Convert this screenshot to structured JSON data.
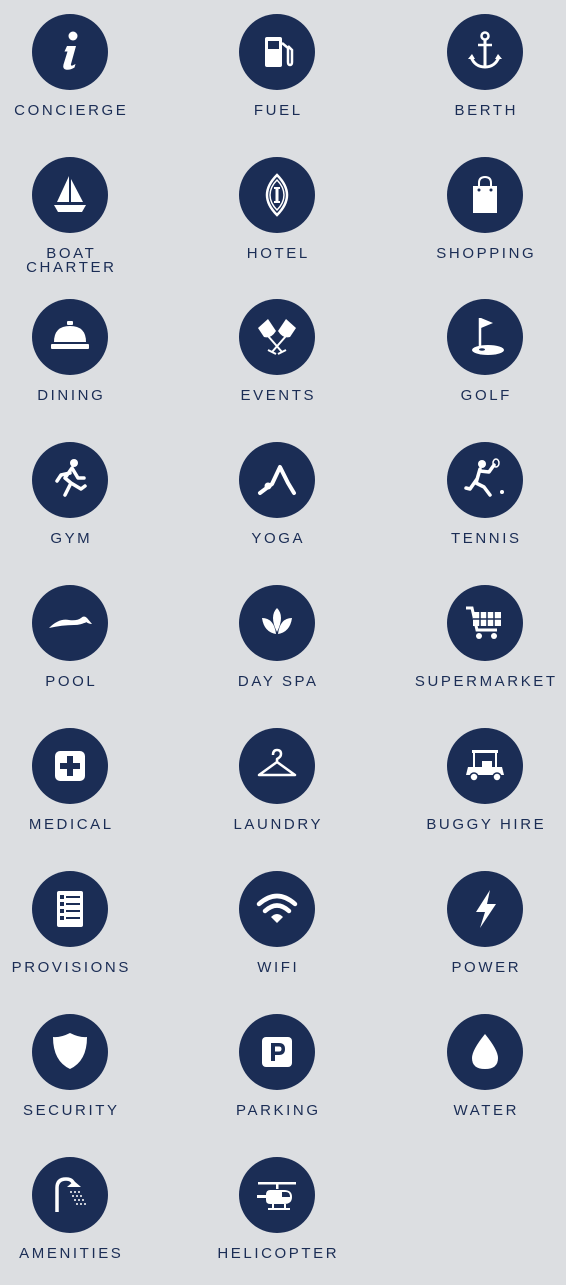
{
  "colors": {
    "background": "#dcdee1",
    "icon_circle": "#1b2d55",
    "icon_glyph": "#ffffff",
    "label_text": "#1b2d55"
  },
  "services": [
    {
      "label": "CONCIERGE",
      "icon": "info-icon"
    },
    {
      "label": "FUEL",
      "icon": "fuel-pump-icon"
    },
    {
      "label": "BERTH",
      "icon": "anchor-icon"
    },
    {
      "label": "BOAT\nCHARTER",
      "icon": "sailboat-icon"
    },
    {
      "label": "HOTEL",
      "icon": "hotel-emblem-icon"
    },
    {
      "label": "SHOPPING",
      "icon": "shopping-bag-icon"
    },
    {
      "label": "DINING",
      "icon": "cloche-icon"
    },
    {
      "label": "EVENTS",
      "icon": "champagne-glasses-icon"
    },
    {
      "label": "GOLF",
      "icon": "golf-flag-icon"
    },
    {
      "label": "GYM",
      "icon": "runner-icon"
    },
    {
      "label": "YOGA",
      "icon": "yoga-pose-icon"
    },
    {
      "label": "TENNIS",
      "icon": "tennis-player-icon"
    },
    {
      "label": "POOL",
      "icon": "swimmer-icon"
    },
    {
      "label": "DAY SPA",
      "icon": "lotus-icon"
    },
    {
      "label": "SUPERMARKET",
      "icon": "shopping-cart-icon"
    },
    {
      "label": "MEDICAL",
      "icon": "medical-cross-icon"
    },
    {
      "label": "LAUNDRY",
      "icon": "hanger-icon"
    },
    {
      "label": "BUGGY HIRE",
      "icon": "golf-buggy-icon"
    },
    {
      "label": "PROVISIONS",
      "icon": "checklist-icon"
    },
    {
      "label": "WIFI",
      "icon": "wifi-icon"
    },
    {
      "label": "POWER",
      "icon": "lightning-bolt-icon"
    },
    {
      "label": "SECURITY",
      "icon": "shield-icon"
    },
    {
      "label": "PARKING",
      "icon": "parking-sign-icon"
    },
    {
      "label": "WATER",
      "icon": "water-drop-icon"
    },
    {
      "label": "AMENITIES",
      "icon": "shower-icon"
    },
    {
      "label": "HELICOPTER",
      "icon": "helicopter-icon"
    }
  ]
}
